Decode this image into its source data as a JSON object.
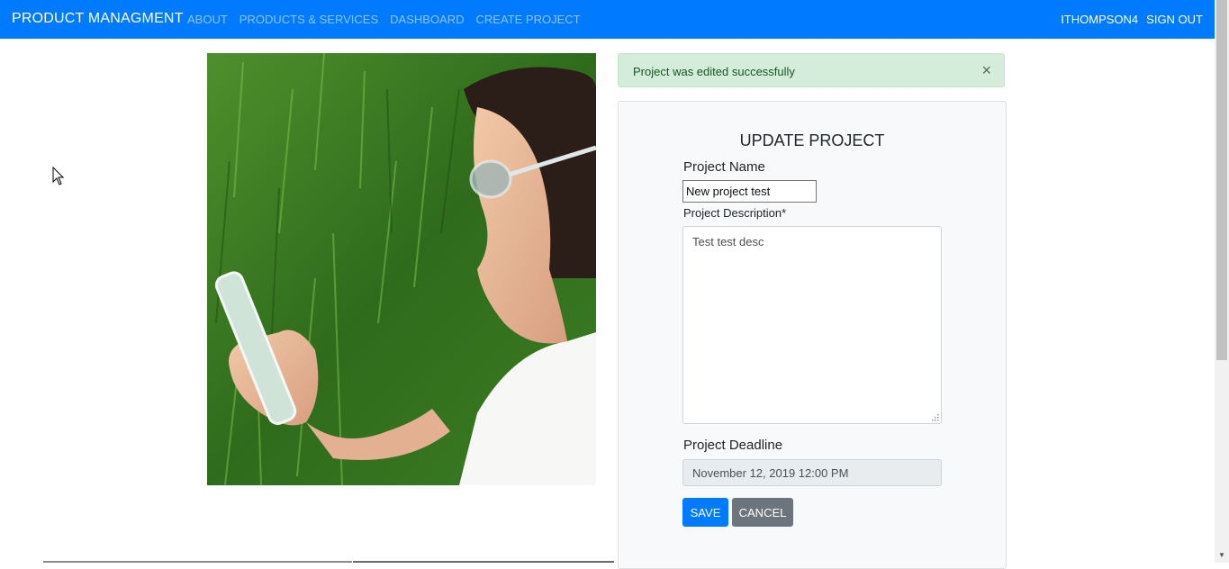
{
  "navbar": {
    "brand": "PRODUCT MANAGMENT",
    "links": [
      "ABOUT",
      "PRODUCTS & SERVICES",
      "DASHBOARD",
      "CREATE PROJECT"
    ],
    "user": "ITHOMPSON4",
    "sign_out": "SIGN OUT"
  },
  "alert": {
    "message": "Project was edited successfully",
    "close": "×"
  },
  "form": {
    "title": "UPDATE PROJECT",
    "name_label": "Project Name",
    "name_value": "New project test",
    "description_label": "Project Description*",
    "description_value": "Test test desc",
    "deadline_label": "Project Deadline",
    "deadline_value": "November 12, 2019 12:00 PM",
    "save_label": "SAVE",
    "cancel_label": "CANCEL"
  },
  "colors": {
    "primary": "#007bff",
    "success_bg": "#d4edda",
    "success_text": "#155724",
    "secondary": "#6c757d"
  }
}
